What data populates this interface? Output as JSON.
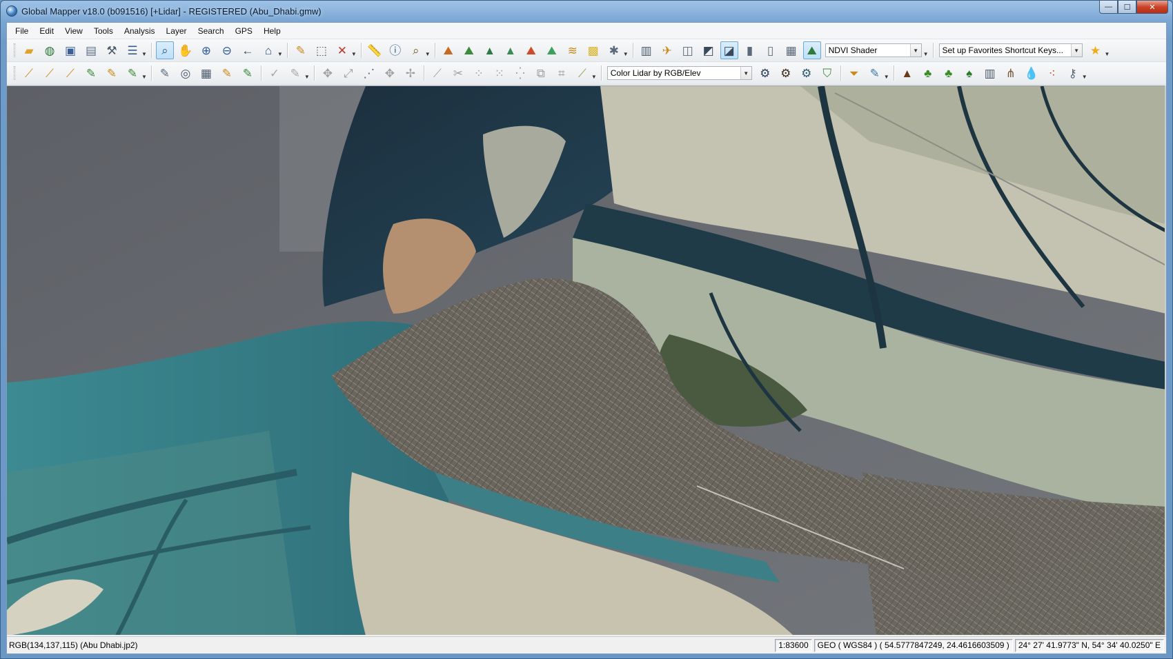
{
  "window": {
    "title": "Global Mapper v18.0 (b091516) [+Lidar] - REGISTERED (Abu_Dhabi.gmw)",
    "controls": {
      "minimize": "—",
      "maximize": "☐",
      "close": "✕"
    }
  },
  "menu": [
    "File",
    "Edit",
    "View",
    "Tools",
    "Analysis",
    "Layer",
    "Search",
    "GPS",
    "Help"
  ],
  "toolbar1": {
    "icons_group_a": [
      "open-folder-icon",
      "globe-icon",
      "save-icon",
      "map-layout-icon",
      "wrench-icon",
      "layers-icon"
    ],
    "icons_group_b": [
      "zoom-tool-icon",
      "pan-hand-icon",
      "zoom-in-icon",
      "zoom-out-icon",
      "back-arrow-icon",
      "home-icon"
    ],
    "icons_group_c": [
      "pencil-icon",
      "select-rect-icon",
      "delete-x-icon"
    ],
    "icons_group_d": [
      "measure-ruler-icon",
      "info-icon",
      "find-icon"
    ],
    "icons_group_e": [
      "terrain-1-icon",
      "terrain-2-icon",
      "terrain-3-icon",
      "terrain-4-icon",
      "profile-icon",
      "volume-icon",
      "contour-icon",
      "shader-icon",
      "satellite-icon"
    ],
    "icons_group_f": [
      "layer-panel-icon",
      "route-icon",
      "split-view-icon",
      "3d-view-icon",
      "lidar-compare-icon",
      "histogram-icon",
      "elevation-chart-icon",
      "chart-icon",
      "ndvi-icon"
    ],
    "shader_combo": "NDVI Shader",
    "favorites_combo": "Set up Favorites Shortcut Keys...",
    "favorites_star": "star-icon"
  },
  "toolbar2": {
    "icons_group_a": [
      "digitize-1-icon",
      "digitize-2-icon",
      "digitize-3-icon",
      "digitize-4-icon",
      "digitize-5-icon",
      "digitize-6-icon"
    ],
    "icons_group_b": [
      "edit-1-icon",
      "target-icon",
      "grid-icon",
      "edit-2-icon",
      "edit-3-icon"
    ],
    "icons_group_c": [
      "check-icon",
      "edit-pen-icon"
    ],
    "icons_group_d": [
      "move-icon",
      "resize-icon",
      "vertex-icon",
      "move-vertex-icon",
      "snap-icon"
    ],
    "icons_group_e": [
      "line-tool-icon",
      "cut-icon",
      "point-cloud-1-icon",
      "point-cloud-2-icon",
      "point-cloud-3-icon",
      "point-cloud-4-icon",
      "crop-icon",
      "measure-icon"
    ],
    "lidar_combo": "Color Lidar by RGB/Elev",
    "icons_group_f": [
      "lidar-gear-1-icon",
      "lidar-gear-2-icon",
      "lidar-gear-3-icon",
      "lidar-filter-icon"
    ],
    "icons_group_g": [
      "funnel-icon",
      "edit-check-icon"
    ],
    "icons_group_h": [
      "ground-icon",
      "vegetation-low-icon",
      "vegetation-med-icon",
      "tree-icon",
      "building-icon",
      "powerline-icon",
      "water-icon",
      "noise-icon",
      "key-icon"
    ]
  },
  "map": {
    "description_colors": {
      "water_deep": "#1f3f4f",
      "water_shallow": "#3f7f86",
      "sand": "#c9c7b6",
      "urban": "#6f6a61",
      "sea_gray": "#6b6d72"
    }
  },
  "status": {
    "pixel": "RGB(134,137,115) (Abu Dhabi.jp2)",
    "scale": "1:83600",
    "coords": "GEO ( WGS84 ) ( 54.5777847249, 24.4616603509 )",
    "dms": "24° 27' 41.9773\" N, 54° 34' 40.0250\" E"
  }
}
